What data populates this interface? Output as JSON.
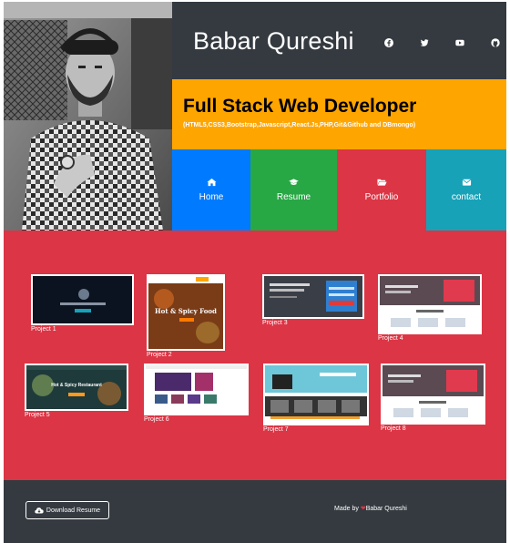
{
  "header": {
    "name": "Babar Qureshi",
    "social_icons": [
      "facebook-icon",
      "twitter-icon",
      "youtube-icon",
      "github-icon"
    ]
  },
  "banner": {
    "title": "Full Stack Web Developer",
    "skills": "(HTML5,CSS3,Bootstrap,Javascript,React.Js,PHP,Git&Github and DBmongo)"
  },
  "nav": {
    "items": [
      {
        "label": "Home",
        "icon": "home-icon",
        "color": "#007bff"
      },
      {
        "label": "Resume",
        "icon": "graduation-cap-icon",
        "color": "#28a745"
      },
      {
        "label": "Portfolio",
        "icon": "folder-open-icon",
        "color": "#dc3545"
      },
      {
        "label": "contact",
        "icon": "envelope-icon",
        "color": "#17a2b8"
      }
    ]
  },
  "portfolio": {
    "projects": [
      {
        "label": "Project 1"
      },
      {
        "label": "Project 2",
        "thumb_text": "Hot & Spicy Food"
      },
      {
        "label": "Project 3"
      },
      {
        "label": "Project 4"
      },
      {
        "label": "Project 5",
        "thumb_text": "Hot & Spicy Restaurant"
      },
      {
        "label": "Project 6"
      },
      {
        "label": "Project 7"
      },
      {
        "label": "Project 8"
      }
    ]
  },
  "footer": {
    "download_label": "Download Resume",
    "made_by_prefix": "Made by",
    "made_by_name": "Babar Qureshi"
  },
  "colors": {
    "dark": "#343a40",
    "orange": "#ffa500",
    "red": "#dc3545",
    "blue": "#007bff",
    "green": "#28a745",
    "teal": "#17a2b8"
  }
}
